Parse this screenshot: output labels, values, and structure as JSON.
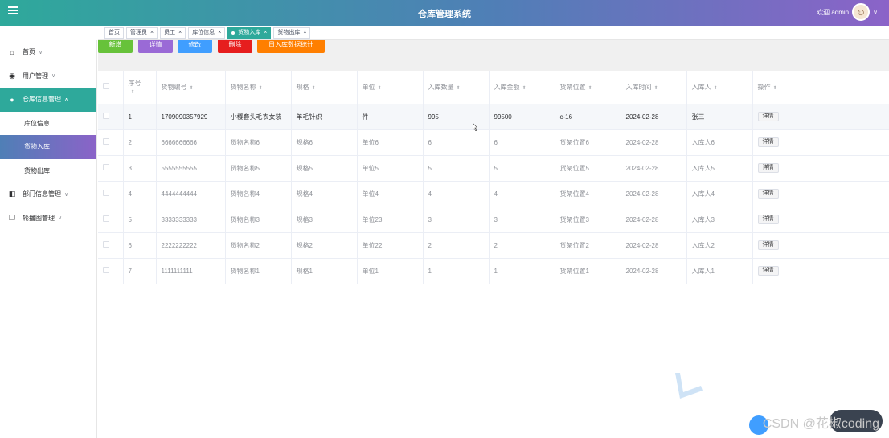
{
  "header": {
    "title": "仓库管理系统",
    "welcome": "欢迎 admin",
    "menu_icon": "hamburger-icon"
  },
  "tabs": [
    {
      "label": "首页",
      "closable": false,
      "active": false
    },
    {
      "label": "管理员",
      "closable": true,
      "active": false
    },
    {
      "label": "员工",
      "closable": true,
      "active": false
    },
    {
      "label": "库位信息",
      "closable": true,
      "active": false
    },
    {
      "label": "货物入库",
      "closable": true,
      "active": true
    },
    {
      "label": "货物出库",
      "closable": true,
      "active": false
    }
  ],
  "sidebar": {
    "items": [
      {
        "label": "首页",
        "icon": "home-icon",
        "arrow": "∨"
      },
      {
        "label": "用户管理",
        "icon": "user-icon",
        "arrow": "∨"
      },
      {
        "label": "仓库信息管理",
        "icon": "drop-icon",
        "arrow": "∧"
      },
      {
        "label": "库位信息",
        "sub": true
      },
      {
        "label": "货物入库",
        "sub": true,
        "active": true
      },
      {
        "label": "货物出库",
        "sub": true
      },
      {
        "label": "部门信息管理",
        "icon": "panel-icon",
        "arrow": "∨"
      },
      {
        "label": "轮播图管理",
        "icon": "copy-icon",
        "arrow": "∨"
      }
    ]
  },
  "toolbar": {
    "add": "新增",
    "detail": "详情",
    "edit": "修改",
    "delete": "删除",
    "stats": "日入库数据统计",
    "colors": {
      "add": "#67c23a",
      "detail": "#9a6ad6",
      "edit": "#409eff",
      "delete": "#e61e1e",
      "stats": "#ff7f00"
    }
  },
  "table": {
    "headers": [
      "序号",
      "货物编号",
      "货物名称",
      "规格",
      "单位",
      "入库数量",
      "入库金额",
      "货架位置",
      "入库时间",
      "入库人",
      "操作"
    ],
    "action_label": "详情",
    "rows": [
      [
        "1",
        "1709090357929",
        "小樱套头毛衣女装",
        "羊毛针织",
        "件",
        "995",
        "99500",
        "c-16",
        "2024-02-28",
        "张三"
      ],
      [
        "2",
        "6666666666",
        "货物名称6",
        "规格6",
        "单位6",
        "6",
        "6",
        "货架位置6",
        "2024-02-28",
        "入库人6"
      ],
      [
        "3",
        "5555555555",
        "货物名称5",
        "规格5",
        "单位5",
        "5",
        "5",
        "货架位置5",
        "2024-02-28",
        "入库人5"
      ],
      [
        "4",
        "4444444444",
        "货物名称4",
        "规格4",
        "单位4",
        "4",
        "4",
        "货架位置4",
        "2024-02-28",
        "入库人4"
      ],
      [
        "5",
        "3333333333",
        "货物名称3",
        "规格3",
        "单位23",
        "3",
        "3",
        "货架位置3",
        "2024-02-28",
        "入库人3"
      ],
      [
        "6",
        "2222222222",
        "货物名称2",
        "规格2",
        "单位22",
        "2",
        "2",
        "货架位置2",
        "2024-02-28",
        "入库人2"
      ],
      [
        "7",
        "1111111111",
        "货物名称1",
        "规格1",
        "单位1",
        "1",
        "1",
        "货架位置1",
        "2024-02-28",
        "入库人1"
      ]
    ]
  },
  "watermark": "CSDN @花椒coding",
  "colors": {
    "accent": "#2ea99b",
    "header_end": "#8b63c8"
  }
}
